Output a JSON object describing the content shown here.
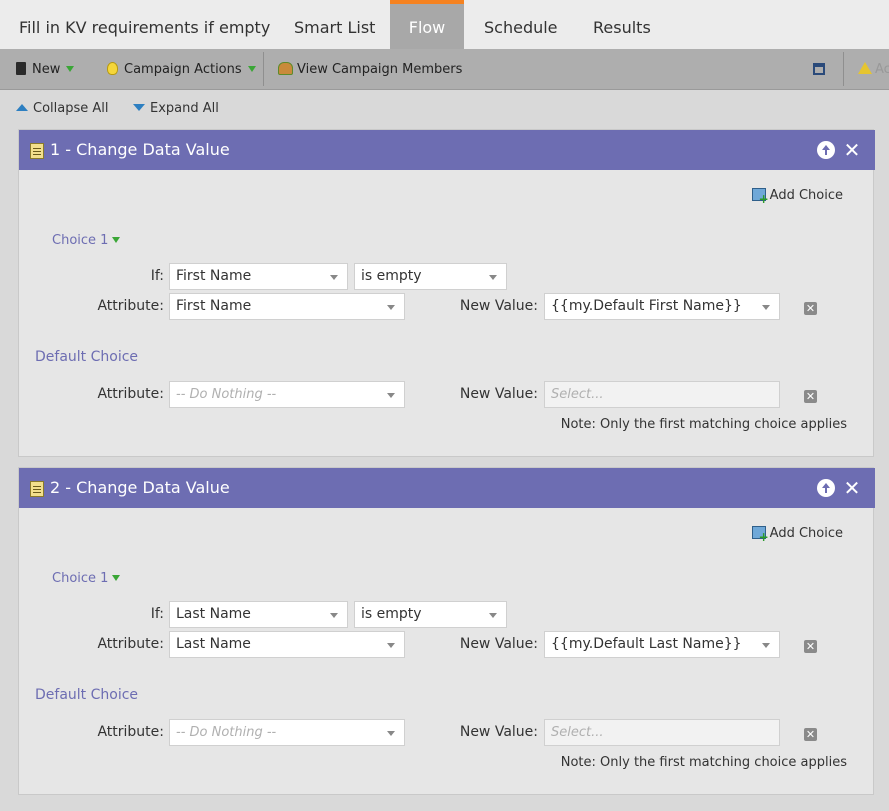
{
  "tabs": [
    {
      "label": "Fill in KV requirements if empty"
    },
    {
      "label": "Smart List"
    },
    {
      "label": "Flow"
    },
    {
      "label": "Schedule"
    },
    {
      "label": "Results"
    }
  ],
  "toolbar": {
    "new_label": "New",
    "campaign_actions_label": "Campaign Actions",
    "view_members_label": "View Campaign Members",
    "right_label": "Ac"
  },
  "collapse": {
    "collapse_label": "Collapse All",
    "expand_label": "Expand All"
  },
  "steps": [
    {
      "title": "1 - Change Data Value",
      "add_choice": "Add Choice",
      "choice_label": "Choice 1",
      "if_label": "If:",
      "if_field": "First Name",
      "if_operator": "is empty",
      "attribute_label": "Attribute:",
      "attribute_value": "First Name",
      "new_value_label": "New Value:",
      "new_value": "{{my.Default First Name}}",
      "default_label": "Default Choice",
      "default_attribute_label": "Attribute:",
      "default_attribute": "-- Do Nothing --",
      "default_new_value_label": "New Value:",
      "default_new_value": "Select...",
      "note": "Note: Only the first matching choice applies"
    },
    {
      "title": "2 - Change Data Value",
      "add_choice": "Add Choice",
      "choice_label": "Choice 1",
      "if_label": "If:",
      "if_field": "Last Name",
      "if_operator": "is empty",
      "attribute_label": "Attribute:",
      "attribute_value": "Last Name",
      "new_value_label": "New Value:",
      "new_value": "{{my.Default Last Name}}",
      "default_label": "Default Choice",
      "default_attribute_label": "Attribute:",
      "default_attribute": "-- Do Nothing --",
      "default_new_value_label": "New Value:",
      "default_new_value": "Select...",
      "note": "Note: Only the first matching choice applies"
    }
  ]
}
